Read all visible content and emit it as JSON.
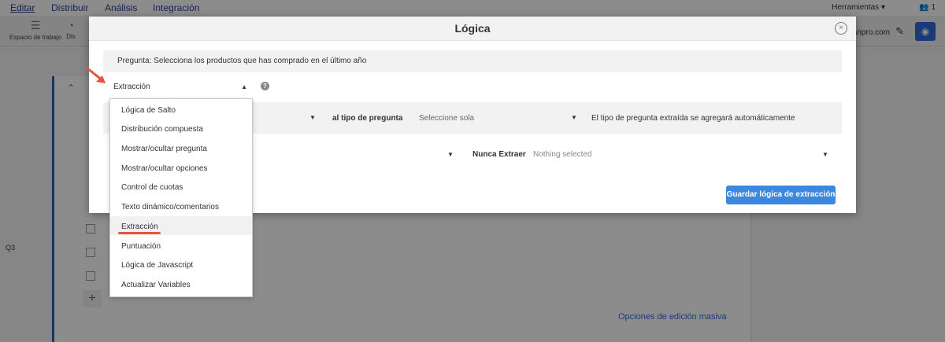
{
  "topnav": {
    "items": [
      "Editar",
      "Distribuir",
      "Análisis",
      "Integración"
    ],
    "tools": "Herramientas",
    "users_count": "1"
  },
  "toolbar": {
    "workspace": "Espacio de trabajo",
    "dis": "Dis",
    "email_fragment": "anpro.com"
  },
  "survey": {
    "question_label": "Q3",
    "mass_edit": "Opciones de edición masiva"
  },
  "modal": {
    "title": "Lógica",
    "question_text": "Pregunta: Selecciona los productos que has comprado en el último año",
    "logic_type": "Extracción",
    "row1": {
      "label": "al tipo de pregunta",
      "select_value": "Seleccione sola",
      "note": "El tipo de pregunta extraída se agregará automáticamente"
    },
    "row2": {
      "label": "Nunca Extraer",
      "select_value": "Nothing selected"
    },
    "save_label": "Guardar lógica de extracción"
  },
  "dropdown": {
    "items": [
      "Lógica de Salto",
      "Distribución compuesta",
      "Mostrar/ocultar pregunta",
      "Mostrar/ocultar opciones",
      "Control de cuotas",
      "Texto dinámico/comentarios",
      "Extracción",
      "Puntuación",
      "Lógica de Javascript",
      "Actualizar Variables"
    ],
    "selected_index": 6
  },
  "colors": {
    "primary": "#3c87e0",
    "annotation": "#e8553a",
    "nav": "#2a3f8f"
  }
}
